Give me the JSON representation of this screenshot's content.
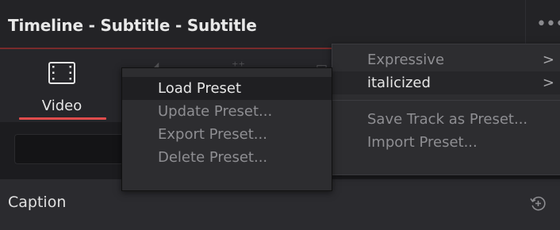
{
  "header": {
    "title": "Timeline - Subtitle - Subtitle",
    "more_glyph": "•••"
  },
  "tabs": {
    "active": {
      "label": "Video",
      "icon": "film-icon"
    },
    "accent_color": "#e04c4c"
  },
  "caption": {
    "label": "Caption",
    "reset_icon": "reset-icon"
  },
  "preset_menu": {
    "items": [
      {
        "label": "Load Preset",
        "enabled": true,
        "highlighted": true
      },
      {
        "label": "Update Preset...",
        "enabled": false
      },
      {
        "label": "Export Preset...",
        "enabled": false
      },
      {
        "label": "Delete Preset...",
        "enabled": false
      }
    ]
  },
  "load_submenu": {
    "items": [
      {
        "label": "Expressive",
        "enabled": false,
        "has_submenu": true,
        "arrow": ">"
      },
      {
        "label": "italicized",
        "enabled": true,
        "has_submenu": true,
        "arrow": ">",
        "highlighted": true
      }
    ],
    "actions": [
      {
        "label": "Save Track as Preset...",
        "enabled": false
      },
      {
        "label": "Import Preset...",
        "enabled": false
      }
    ]
  }
}
